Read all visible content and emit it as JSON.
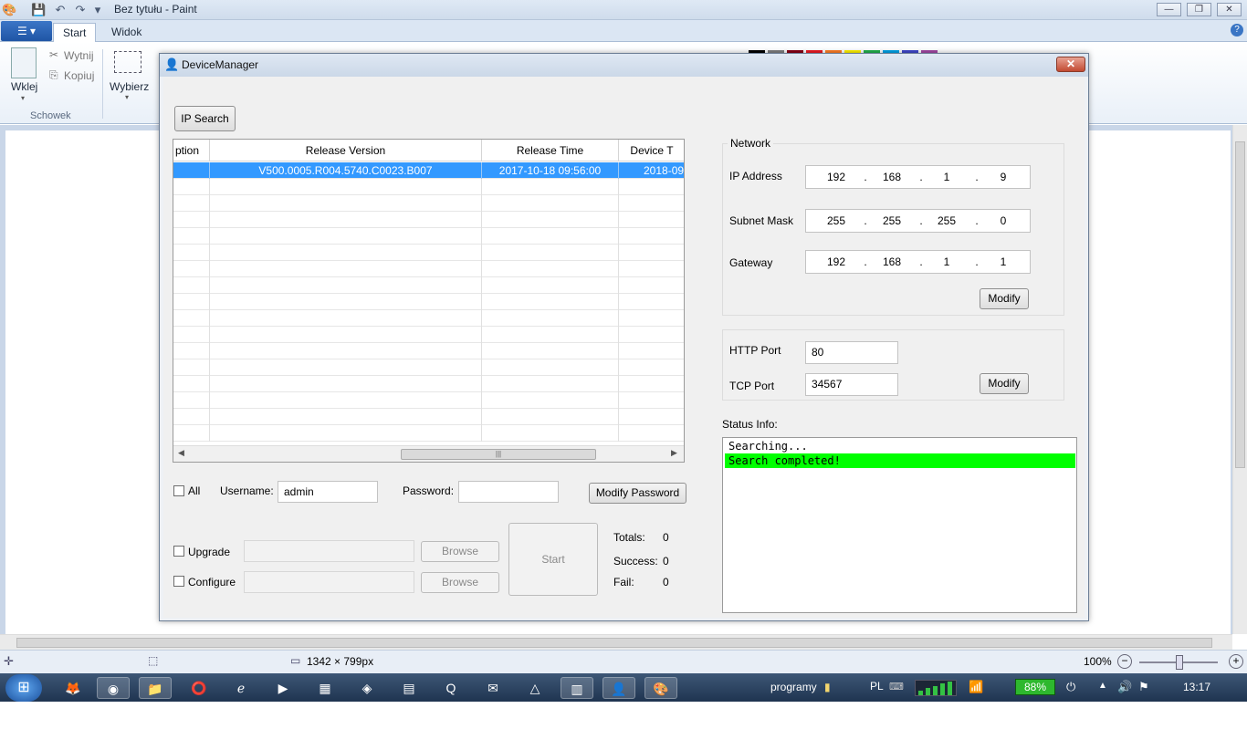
{
  "paint": {
    "title": "Bez tytułu - Paint",
    "tabs": [
      "Start",
      "Widok"
    ],
    "clipboard": {
      "paste": "Wklej",
      "cut": "Wytnij",
      "copy": "Kopiuj",
      "group": "Schowek"
    },
    "select": "Wybierz",
    "statusbar": {
      "dimensions": "1342 × 799px",
      "zoom": "100%"
    }
  },
  "dialog": {
    "title": "DeviceManager",
    "ip_search_label": "IP Search",
    "table": {
      "headers": [
        "ption",
        "Release Version",
        "Release Time",
        "Device T"
      ],
      "rows": [
        [
          "",
          "V500.0005.R004.5740.C0023.B007",
          "2017-10-18 09:56:00",
          "2018-09"
        ]
      ]
    },
    "network": {
      "title": "Network",
      "ip_label": "IP Address",
      "ip": [
        "192",
        "168",
        "1",
        "9"
      ],
      "mask_label": "Subnet Mask",
      "mask": [
        "255",
        "255",
        "255",
        "0"
      ],
      "gateway_label": "Gateway",
      "gateway": [
        "192",
        "168",
        "1",
        "1"
      ],
      "modify": "Modify"
    },
    "ports": {
      "http_label": "HTTP Port",
      "http": "80",
      "tcp_label": "TCP Port",
      "tcp": "34567",
      "modify": "Modify"
    },
    "auth": {
      "all_label": "All",
      "username_label": "Username:",
      "username": "admin",
      "password_label": "Password:",
      "password": "",
      "modify_password": "Modify Password"
    },
    "upgrade": {
      "upgrade_label": "Upgrade",
      "configure_label": "Configure",
      "browse": "Browse",
      "start": "Start"
    },
    "totals": {
      "totals_label": "Totals:",
      "totals": "0",
      "success_label": "Success:",
      "success": "0",
      "fail_label": "Fail:",
      "fail": "0"
    },
    "status": {
      "label": "Status Info:",
      "lines": [
        "Searching...",
        "Search completed!"
      ],
      "highlight_color": "#00ff00"
    }
  },
  "taskbar": {
    "toolbar_label": "programy",
    "language": "PL",
    "battery": "88%",
    "time": "13:17"
  },
  "colors": {
    "selection": "#3399ff",
    "status_highlight": "#00ff00",
    "close_button": "#c24a32"
  }
}
